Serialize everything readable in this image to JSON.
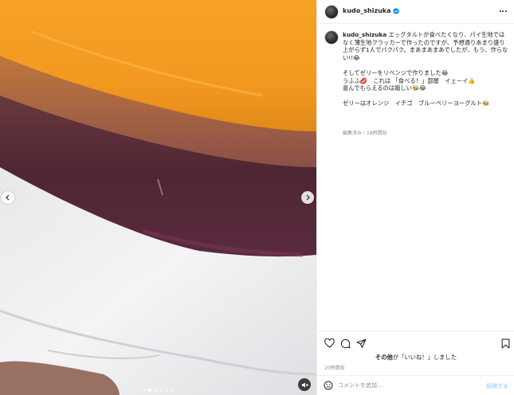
{
  "post": {
    "username": "kudo_shizuka",
    "verified": true,
    "more_icon": "more-horizontal-icon"
  },
  "caption": {
    "username": "kudo_shizuka",
    "lines": [
      "エッグタルトが食べたくなり、パイ生地ではなく薄生地クラッカーで作ったのですが、予想通りあまり盛り上がらず1人でパクパク。まあまあまあでしたが、もう、作らない!!😂",
      "",
      "そしてゼリーをリベンジで作りました😂",
      "うふふ💋　これは 「食べる！」部屋　イェーイ👍",
      "喜んでもらえるのは嬉しい🐝😂",
      "",
      "ゼリーはオレンジ　イチゴ　ブルーベリーヨーグルト🐝"
    ],
    "edited_time": "編集済み・18時間前"
  },
  "actions": {
    "like_icon": "heart-icon",
    "comment_icon": "comment-icon",
    "share_icon": "send-icon",
    "save_icon": "bookmark-icon"
  },
  "likes": {
    "by_user": "その他",
    "suffix": "が「いいね！」しました"
  },
  "post_time": "20時間前",
  "comment_box": {
    "placeholder": "コメントを追加...",
    "post_label": "投稿する",
    "emoji_icon": "emoji-smile-icon"
  },
  "media": {
    "slide_count": 6,
    "active_slide": 2,
    "prev_icon": "chevron-left-icon",
    "next_icon": "chevron-right-icon",
    "mute_icon": "speaker-muted-icon"
  },
  "colors": {
    "border": "#efefef",
    "text": "#262626",
    "muted": "#8e8e8e",
    "verified": "#0095f6",
    "post_button": "#b3dbff"
  }
}
